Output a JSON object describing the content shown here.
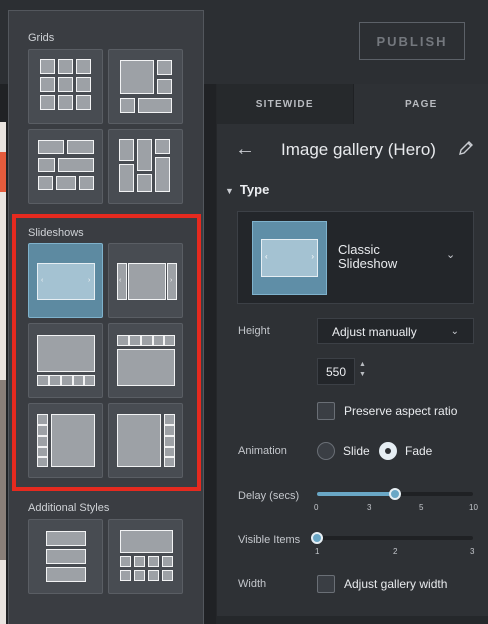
{
  "toolbar": {
    "publish_label": "PUBLISH"
  },
  "tabs": [
    {
      "label": "SITEWIDE"
    },
    {
      "label": "PAGE"
    }
  ],
  "panel": {
    "title": "Image gallery (Hero)",
    "type_heading": "Type",
    "type_value_line1": "Classic",
    "type_value_line2": "Slideshow",
    "height": {
      "label": "Height",
      "selected": "Adjust manually",
      "value": "550"
    },
    "preserve_aspect_label": "Preserve aspect ratio",
    "animation": {
      "label": "Animation",
      "options": [
        "Slide",
        "Fade"
      ],
      "selected": "Fade"
    },
    "delay": {
      "label": "Delay (secs)",
      "ticks": [
        "0",
        "3",
        "5",
        "10"
      ],
      "value": 5,
      "max": 10
    },
    "visible_items": {
      "label": "Visible Items",
      "ticks": [
        "1",
        "2",
        "3"
      ],
      "value": 1,
      "min": 1,
      "max": 3
    },
    "width": {
      "label": "Width",
      "checkbox_label": "Adjust gallery width"
    }
  },
  "picker": {
    "sections": [
      {
        "label": "Grids"
      },
      {
        "label": "Slideshows"
      },
      {
        "label": "Additional Styles"
      }
    ],
    "arrow_left": "‹",
    "arrow_right": "›"
  },
  "colors": {
    "highlight": "#e52a1f",
    "accent": "#6aa7c6"
  }
}
